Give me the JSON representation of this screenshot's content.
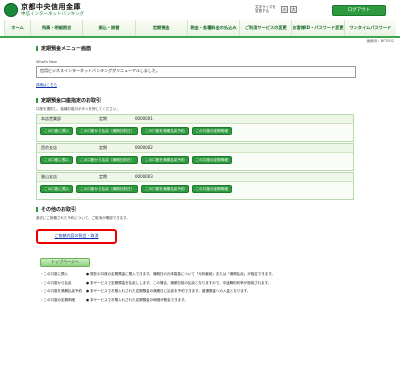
{
  "header": {
    "bank_name": "京都中央信用金庫",
    "sub_name": "中信インターネットバンキング",
    "fontsize_label_1": "文字サイズを",
    "fontsize_label_2": "変更する",
    "fontsize_small": "小",
    "fontsize_large": "大",
    "logout": "ログアウト"
  },
  "nav": {
    "items": [
      {
        "label": "ホーム"
      },
      {
        "label": "残高・明細照会"
      },
      {
        "label": "振込・振替"
      },
      {
        "label": "定期預金"
      },
      {
        "label": "税金・各種料金の払込み"
      },
      {
        "label": "ご利用サービスの変更"
      },
      {
        "label": "お客様ID・パスワード変更"
      },
      {
        "label": "ワンタイムパスワード"
      }
    ]
  },
  "screen_id": "画面ID：BFT002",
  "menu_title": "定期預金メニュー画面",
  "whats_new": {
    "label": "What's New",
    "message": "信用ビジネスインターネットバンキングがリニューアルしました。",
    "more_link": "詳細はこちら"
  },
  "accounts_section": {
    "title": "定期預金口座指定のお取引",
    "instruction": "口座を選択し、各種お取引ボタンを押してください。",
    "accounts": [
      {
        "branch": "本店営業部",
        "type": "定期",
        "number": "0000001"
      },
      {
        "branch": "西京支店",
        "type": "定期",
        "number": "0000002"
      },
      {
        "branch": "嵐山支店",
        "type": "定期",
        "number": "0000003"
      }
    ],
    "buttons": [
      "この口座に預入",
      "この口座から払戻（満期日前日）",
      "この口座を満期払戻予約",
      "この口座の定期明細"
    ]
  },
  "other_section": {
    "title": "その他のお取引",
    "instruction": "過去にご依頼された予約について、ご取消が確認できます。",
    "cancel_link": "ご依頼内容の照会・取消"
  },
  "top_button": "トップページへ",
  "notes": [
    {
      "key": "・この口座に預入",
      "value": "● 現在の口座の定期預金に預入できます。満期日の元本取扱について「元利継続」または「満期払戻」が指定できます。"
    },
    {
      "key": "・この口座から払戻",
      "value": "● 本サービスで定期預金を払戻しします。この場合、満期日前の払戻となりますので、中途解約利率が適用されます。"
    },
    {
      "key": "・この口座を満期払戻予約",
      "value": "● 本サービスでお預入れされた定期預金の満期日に払戻を予約できます。普通預金への入金となります。"
    },
    {
      "key": "・この口座の定期明細",
      "value": "● 本サービスでお預入れされた定期預金の明細が照会できます。"
    }
  ]
}
